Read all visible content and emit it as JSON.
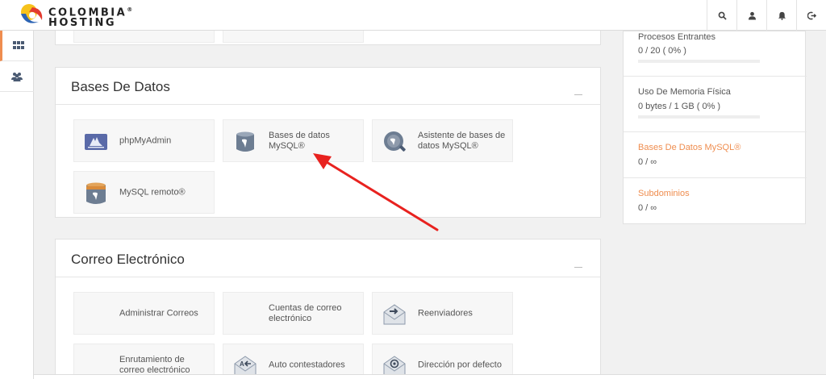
{
  "brand": {
    "line1": "COLOMBIA",
    "line2": "HOSTING",
    "reg": "®"
  },
  "topbar": {
    "icons": [
      "search-icon",
      "user-icon",
      "bell-icon",
      "logout-icon"
    ]
  },
  "leftnav": {
    "items": [
      "grid-icon",
      "users-icon"
    ]
  },
  "databases": {
    "title": "Bases De Datos",
    "tiles": [
      {
        "label": "phpMyAdmin",
        "icon": "phpmyadmin-icon"
      },
      {
        "label": "Bases de datos MySQL®",
        "icon": "database-icon"
      },
      {
        "label": "Asistente de bases de datos MySQL®",
        "icon": "database-wizard-icon"
      },
      {
        "label": "MySQL remoto®",
        "icon": "remote-mysql-icon"
      }
    ]
  },
  "email": {
    "title": "Correo Electrónico",
    "tiles": [
      {
        "label": "Administrar Correos",
        "icon": ""
      },
      {
        "label": "Cuentas de correo electrónico",
        "icon": ""
      },
      {
        "label": "Reenviadores",
        "icon": "forwarders-icon"
      },
      {
        "label": "Enrutamiento de correo electrónico",
        "icon": ""
      },
      {
        "label": "Auto contestadores",
        "icon": "autoresponder-icon"
      },
      {
        "label": "Dirección por defecto",
        "icon": "default-address-icon"
      }
    ]
  },
  "stats": {
    "items": [
      {
        "label": "Procesos Entrantes",
        "value": "0 / 20 ( 0% )",
        "fraction": 0
      },
      {
        "label": "Uso De Memoria Física",
        "value": "0 bytes / 1 GB ( 0% )",
        "fraction": 0
      },
      {
        "label": "Bases De Datos MySQL®",
        "value": "0 / ∞"
      },
      {
        "label": "Subdominios",
        "value": "0 / ∞"
      }
    ]
  },
  "colors": {
    "accent": "#ef8d4f",
    "annotation_arrow": "#e8221f",
    "icon": "#4a5a72"
  }
}
